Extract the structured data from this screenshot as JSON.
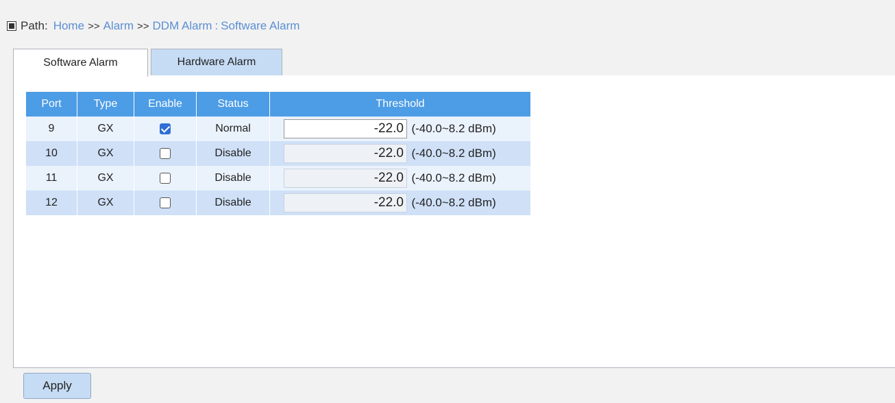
{
  "path": {
    "label": "Path:",
    "crumbs": [
      "Home",
      "Alarm",
      "DDM Alarm"
    ],
    "separator": ">>",
    "colon": ":",
    "current": "Software Alarm"
  },
  "tabs": [
    {
      "label": "Software Alarm",
      "active": true
    },
    {
      "label": "Hardware Alarm",
      "active": false
    }
  ],
  "table": {
    "headers": [
      "Port",
      "Type",
      "Enable",
      "Status",
      "Threshold"
    ],
    "rows": [
      {
        "port": "9",
        "type": "GX",
        "enabled": true,
        "status": "Normal",
        "threshold": "-22.0",
        "range": "(-40.0~8.2 dBm)"
      },
      {
        "port": "10",
        "type": "GX",
        "enabled": false,
        "status": "Disable",
        "threshold": "-22.0",
        "range": "(-40.0~8.2 dBm)"
      },
      {
        "port": "11",
        "type": "GX",
        "enabled": false,
        "status": "Disable",
        "threshold": "-22.0",
        "range": "(-40.0~8.2 dBm)"
      },
      {
        "port": "12",
        "type": "GX",
        "enabled": false,
        "status": "Disable",
        "threshold": "-22.0",
        "range": "(-40.0~8.2 dBm)"
      }
    ]
  },
  "apply_label": "Apply",
  "colors": {
    "header_bg": "#4c9ce6",
    "link": "#5a8ed3",
    "row_light": "#eaf2fc",
    "row_dark": "#cfe0f7",
    "checkbox_checked": "#2f6fd6"
  },
  "icons": {
    "path": "square-bullet-icon",
    "checkbox": "checkbox-icon"
  }
}
